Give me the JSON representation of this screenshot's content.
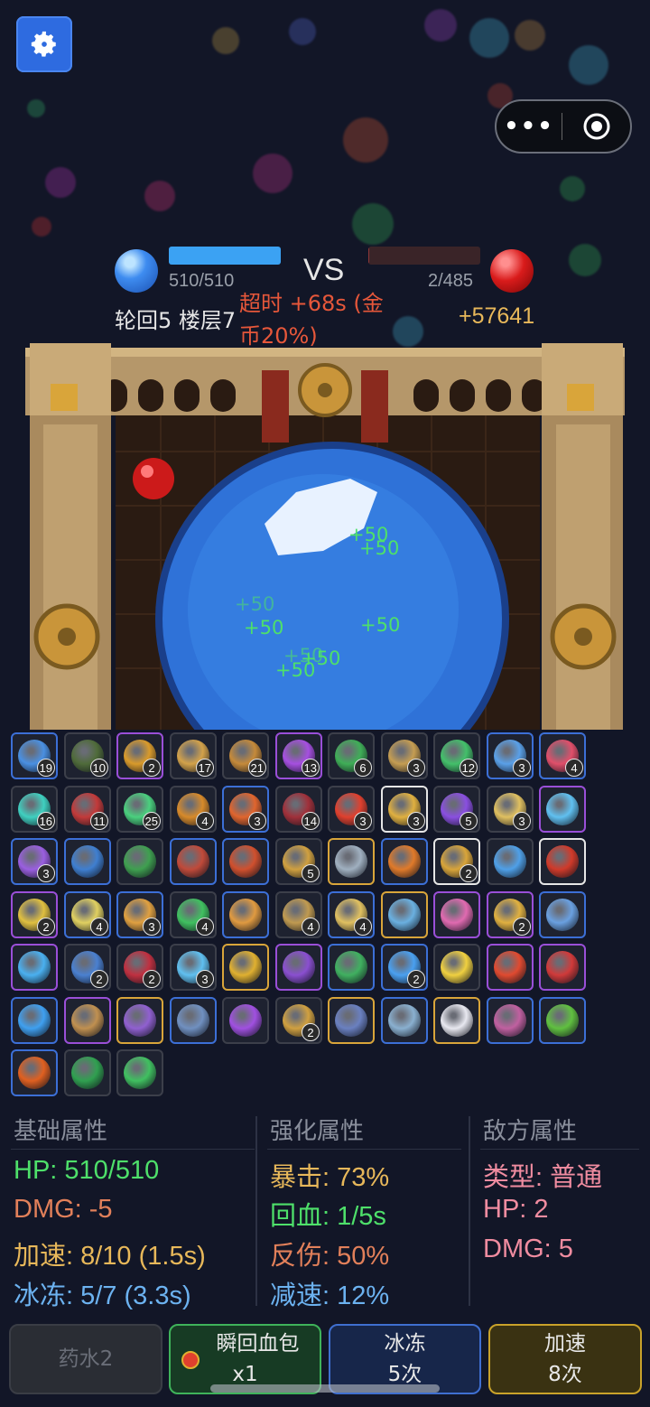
{
  "player": {
    "hp_text": "510/510",
    "hp_fraction": 1.0,
    "progress": "轮回5 楼层7"
  },
  "vs_label": "VS",
  "timeout_text_line1": "超时 +68s (金",
  "timeout_text_line2": "币20%)",
  "enemy": {
    "hp_text": "2/485",
    "hp_fraction": 0.004,
    "reward": "+57641"
  },
  "heal_popups": [
    "+50",
    "+50",
    "+50",
    "+50",
    "+50",
    "+50",
    "+50",
    "+50"
  ],
  "inventory": [
    {
      "tier": "b",
      "color": "#4a90e2",
      "count": "19"
    },
    {
      "tier": "n",
      "color": "#4f6b3a",
      "count": "10"
    },
    {
      "tier": "p",
      "color": "#d99a2b",
      "count": "2"
    },
    {
      "tier": "n",
      "color": "#d3a24a",
      "count": "17"
    },
    {
      "tier": "n",
      "color": "#c58a3a",
      "count": "21"
    },
    {
      "tier": "p",
      "color": "#a64fe0",
      "count": "13"
    },
    {
      "tier": "n",
      "color": "#3fae57",
      "count": "6"
    },
    {
      "tier": "n",
      "color": "#c59d52",
      "count": "3"
    },
    {
      "tier": "n",
      "color": "#43c06a",
      "count": "12"
    },
    {
      "tier": "b",
      "color": "#5aa0e8",
      "count": "3"
    },
    {
      "tier": "b",
      "color": "#e04f6a",
      "count": "4"
    },
    {
      "tier": "n",
      "color": "#3fd0c0",
      "count": "16"
    },
    {
      "tier": "n",
      "color": "#c23a3a",
      "count": "11"
    },
    {
      "tier": "n",
      "color": "#4ad07e",
      "count": "25"
    },
    {
      "tier": "n",
      "color": "#d78a2a",
      "count": "4"
    },
    {
      "tier": "b",
      "color": "#e0652e",
      "count": "3"
    },
    {
      "tier": "n",
      "color": "#a0303a",
      "count": "14"
    },
    {
      "tier": "n",
      "color": "#e0402e",
      "count": "3"
    },
    {
      "tier": "w",
      "color": "#e0b040",
      "count": "3"
    },
    {
      "tier": "n",
      "color": "#8a4fe0",
      "count": "5"
    },
    {
      "tier": "n",
      "color": "#e0c060",
      "count": "3"
    },
    {
      "tier": "p",
      "color": "#60c0f0",
      "count": ""
    },
    {
      "tier": "b",
      "color": "#9a5fe0",
      "count": "3"
    },
    {
      "tier": "b",
      "color": "#3f7fd0",
      "count": ""
    },
    {
      "tier": "n",
      "color": "#3fa050",
      "count": ""
    },
    {
      "tier": "b",
      "color": "#c04a3a",
      "count": ""
    },
    {
      "tier": "b",
      "color": "#d0502e",
      "count": ""
    },
    {
      "tier": "n",
      "color": "#d0a040",
      "count": "5"
    },
    {
      "tier": "g",
      "color": "#a0b0c0",
      "count": ""
    },
    {
      "tier": "b",
      "color": "#e07a2a",
      "count": ""
    },
    {
      "tier": "w",
      "color": "#d9a53a",
      "count": "2"
    },
    {
      "tier": "n",
      "color": "#4fa0e8",
      "count": ""
    },
    {
      "tier": "w",
      "color": "#d03a2a",
      "count": ""
    },
    {
      "tier": "p",
      "color": "#e0c040",
      "count": "2"
    },
    {
      "tier": "b",
      "color": "#e0d060",
      "count": "4"
    },
    {
      "tier": "b",
      "color": "#e0a040",
      "count": "3"
    },
    {
      "tier": "n",
      "color": "#40c060",
      "count": "4"
    },
    {
      "tier": "b",
      "color": "#e09a40",
      "count": ""
    },
    {
      "tier": "n",
      "color": "#c09a50",
      "count": "4"
    },
    {
      "tier": "b",
      "color": "#e0c060",
      "count": "4"
    },
    {
      "tier": "g",
      "color": "#6ab0e0",
      "count": ""
    },
    {
      "tier": "p",
      "color": "#e06ab0",
      "count": ""
    },
    {
      "tier": "p",
      "color": "#e0b040",
      "count": "2"
    },
    {
      "tier": "b",
      "color": "#6aa0e0",
      "count": ""
    },
    {
      "tier": "p",
      "color": "#4ab0f0",
      "count": ""
    },
    {
      "tier": "n",
      "color": "#4a80d0",
      "count": "2"
    },
    {
      "tier": "n",
      "color": "#c03040",
      "count": "2"
    },
    {
      "tier": "n",
      "color": "#60c0f0",
      "count": "3"
    },
    {
      "tier": "g",
      "color": "#e0b030",
      "count": ""
    },
    {
      "tier": "p",
      "color": "#8a4fd0",
      "count": ""
    },
    {
      "tier": "b",
      "color": "#40b060",
      "count": ""
    },
    {
      "tier": "b",
      "color": "#4aa0f0",
      "count": "2"
    },
    {
      "tier": "n",
      "color": "#f0d040",
      "count": ""
    },
    {
      "tier": "p",
      "color": "#e04a30",
      "count": ""
    },
    {
      "tier": "p",
      "color": "#d03a3a",
      "count": ""
    },
    {
      "tier": "b",
      "color": "#3fa0f0",
      "count": ""
    },
    {
      "tier": "p",
      "color": "#c09050",
      "count": ""
    },
    {
      "tier": "g",
      "color": "#9060d0",
      "count": ""
    },
    {
      "tier": "b",
      "color": "#7090c0",
      "count": ""
    },
    {
      "tier": "n",
      "color": "#a050e0",
      "count": ""
    },
    {
      "tier": "n",
      "color": "#d0a040",
      "count": "2"
    },
    {
      "tier": "g",
      "color": "#6a80c0",
      "count": ""
    },
    {
      "tier": "b",
      "color": "#8ab0d0",
      "count": ""
    },
    {
      "tier": "g",
      "color": "#e8e8f0",
      "count": ""
    },
    {
      "tier": "b",
      "color": "#c060a0",
      "count": ""
    },
    {
      "tier": "b",
      "color": "#60c040",
      "count": ""
    },
    {
      "tier": "b",
      "color": "#e06020",
      "count": ""
    },
    {
      "tier": "n",
      "color": "#30a050",
      "count": ""
    },
    {
      "tier": "n",
      "color": "#40c060",
      "count": ""
    }
  ],
  "panels": {
    "base": {
      "title": "基础属性",
      "hp": "HP: 510/510",
      "dmg": "DMG: -5",
      "speed": "加速: 8/10 (1.5s)",
      "freeze": "冰冻: 5/7 (3.3s)"
    },
    "enhance": {
      "title": "强化属性",
      "crit": "暴击: 73%",
      "regen": "回血: 1/5s",
      "reflect": "反伤: 50%",
      "slow": "减速: 12%"
    },
    "enemy": {
      "title": "敌方属性",
      "type": "类型: 普通",
      "hp": "HP: 2",
      "dmg": "DMG: 5"
    }
  },
  "buttons": {
    "potion": "药水2",
    "heal_pack_line1": "瞬回血包",
    "heal_pack_line2": "x1",
    "freeze_line1": "冰冻",
    "freeze_line2": "5次",
    "speed_line1": "加速",
    "speed_line2": "8次"
  },
  "colors": {
    "hp_green": "#4ee06a",
    "dmg_orange": "#e2805a",
    "gold": "#e8b85a",
    "blue_stat": "#6cb2f0",
    "pink_stat": "#f08ca0",
    "timeout_red": "#e6573a"
  }
}
